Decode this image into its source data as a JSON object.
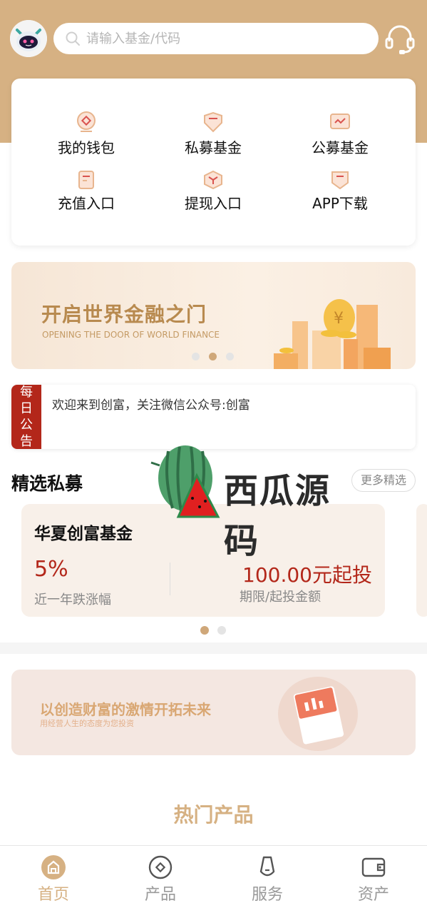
{
  "header": {
    "search_placeholder": "请输入基金/代码",
    "avatar_icon": "robot-avatar-icon",
    "service_icon": "headset-icon"
  },
  "quick_menu": [
    {
      "label": "我的钱包",
      "icon": "wallet-icon"
    },
    {
      "label": "私募基金",
      "icon": "private-fund-icon"
    },
    {
      "label": "公募基金",
      "icon": "public-fund-icon"
    },
    {
      "label": "充值入口",
      "icon": "recharge-icon"
    },
    {
      "label": "提现入口",
      "icon": "withdraw-icon"
    },
    {
      "label": "APP下载",
      "icon": "app-download-icon"
    }
  ],
  "banner": {
    "title": "开启世界金融之门",
    "subtitle": "OPENING THE DOOR OF WORLD FINANCE",
    "active_slide": 2,
    "slide_count": 3
  },
  "notice": {
    "tag": [
      "每",
      "日",
      "公",
      "告"
    ],
    "text": "欢迎来到创富，关注微信公众号:创富"
  },
  "featured": {
    "title": "精选私募",
    "more_label": "更多精选",
    "watermark_text": "西瓜源码",
    "fund": {
      "name": "华夏创富基金",
      "rate": "5%",
      "rate_label": "近一年跌涨幅",
      "amount": "100.00元起投",
      "amount_label": "期限/起投金额"
    },
    "active_slide": 1,
    "slide_count": 2
  },
  "promo_banner": {
    "title": "以创造财富的激情开拓未来",
    "subtitle": "用经营人生的态度为您投资"
  },
  "hot_products_title": "热门产品",
  "tabbar": [
    {
      "label": "首页",
      "icon": "home-icon",
      "active": true
    },
    {
      "label": "产品",
      "icon": "product-icon",
      "active": false
    },
    {
      "label": "服务",
      "icon": "service-icon",
      "active": false
    },
    {
      "label": "资产",
      "icon": "wallet-assets-icon",
      "active": false
    }
  ],
  "colors": {
    "brand": "#d6b183",
    "accent_red": "#b3271a"
  }
}
